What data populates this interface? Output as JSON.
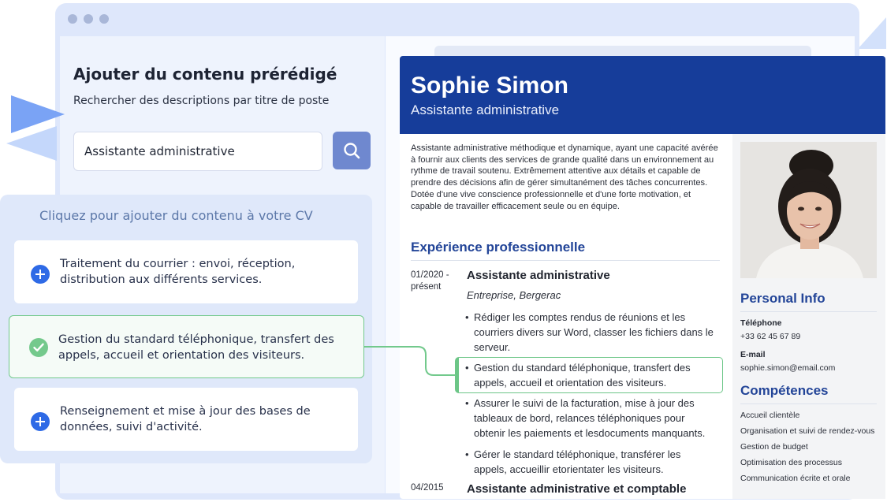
{
  "builder": {
    "title": "Ajouter du contenu prérédigé",
    "subtitle": "Rechercher des descriptions par titre de poste",
    "search_value": "Assistante administrative",
    "suggestions_title": "Cliquez pour ajouter du contenu à votre CV",
    "suggestions": [
      {
        "text": "Traitement du courrier : envoi, réception, distribution aux différents services.",
        "state": "add"
      },
      {
        "text": "Gestion du standard téléphonique, transfert des appels, accueil et orientation des visiteurs.",
        "state": "added"
      },
      {
        "text": "Renseignement et mise à jour des bases de données, suivi d'activité.",
        "state": "add"
      }
    ]
  },
  "resume": {
    "name": "Sophie Simon",
    "role": "Assistante administrative",
    "summary": "Assistante administrative méthodique et dynamique, ayant une capacité avérée à fournir aux clients des services de grande qualité dans un environnement au rythme de travail soutenu. Extrêmement attentive aux détails et capable de prendre des décisions afin de gérer simultanément des tâches concurrentes. Dotée d'une vive conscience professionnelle et d'une forte motivation, et capable de travailler efficacement seule ou en équipe.",
    "experience_title": "Expérience professionnelle",
    "jobs": [
      {
        "date": "01/2020 - présent",
        "title": "Assistante administrative",
        "company": "Entreprise, Bergerac",
        "bullets": [
          "Rédiger les comptes rendus de réunions et les courriers divers sur Word, classer les fichiers dans le serveur.",
          "Gestion du standard téléphonique, transfert des appels, accueil et orientation des visiteurs.",
          "Assurer le suivi de la facturation, mise à jour des tableaux de bord, relances téléphoniques pour obtenir les paiements et lesdocuments manquants.",
          "Gérer le standard téléphonique, transférer les appels, accueillir etorientater les visiteurs."
        ]
      },
      {
        "date": "04/2015",
        "title": "Assistante administrative et comptable"
      }
    ],
    "personal_info_title": "Personal Info",
    "phone_label": "Téléphone",
    "phone": "+33 62 45 67 89",
    "email_label": "E-mail",
    "email": "sophie.simon@email.com",
    "skills_title": "Compétences",
    "skills": [
      "Accueil clientèle",
      "Organisation et suivi de rendez-vous",
      "Gestion de budget",
      "Optimisation des processus",
      "Communication écrite et orale"
    ]
  },
  "colors": {
    "header_blue": "#163d9a",
    "section_blue": "#234598",
    "accent_green": "#72c98c",
    "plus_blue": "#2e6ae6"
  }
}
